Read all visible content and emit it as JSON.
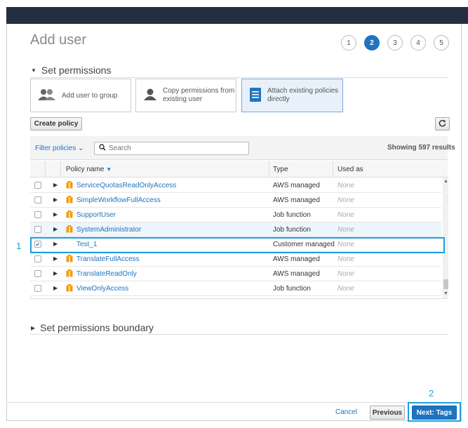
{
  "page": {
    "title": "Add user"
  },
  "steps": [
    "1",
    "2",
    "3",
    "4",
    "5"
  ],
  "active_step": 2,
  "set_permissions": {
    "heading": "Set permissions"
  },
  "options": {
    "add_to_group": "Add user to group",
    "copy_perms_line1": "Copy permissions from",
    "copy_perms_line2": "existing user",
    "attach_line1": "Attach existing policies",
    "attach_line2": "directly"
  },
  "toolbar": {
    "create_policy": "Create policy",
    "refresh_icon": "refresh-icon"
  },
  "filter": {
    "label": "Filter policies",
    "search_placeholder": "Search",
    "showing": "Showing 597 results"
  },
  "table": {
    "columns": [
      "Policy name",
      "Type",
      "Used as"
    ],
    "rows": [
      {
        "name": "ServiceQuotasReadOnlyAccess",
        "type": "AWS managed",
        "used": "None",
        "checked": false,
        "icon": true
      },
      {
        "name": "SimpleWorkflowFullAccess",
        "type": "AWS managed",
        "used": "None",
        "checked": false,
        "icon": true
      },
      {
        "name": "SupportUser",
        "type": "Job function",
        "used": "None",
        "checked": false,
        "icon": true
      },
      {
        "name": "SystemAdministrator",
        "type": "Job function",
        "used": "None",
        "checked": false,
        "icon": true
      },
      {
        "name": "Test_1",
        "type": "Customer managed",
        "used": "None",
        "checked": true,
        "icon": false
      },
      {
        "name": "TranslateFullAccess",
        "type": "AWS managed",
        "used": "None",
        "checked": false,
        "icon": true
      },
      {
        "name": "TranslateReadOnly",
        "type": "AWS managed",
        "used": "None",
        "checked": false,
        "icon": true
      },
      {
        "name": "ViewOnlyAccess",
        "type": "Job function",
        "used": "None",
        "checked": false,
        "icon": true
      }
    ]
  },
  "boundary": {
    "heading": "Set permissions boundary"
  },
  "footer": {
    "cancel": "Cancel",
    "previous": "Previous",
    "next": "Next: Tags"
  },
  "annotations": {
    "one": "1",
    "two": "2"
  },
  "colors": {
    "brand_blue": "#1f74bf",
    "annotation": "#1ea0e0",
    "policy_icon": "#f39c12"
  }
}
